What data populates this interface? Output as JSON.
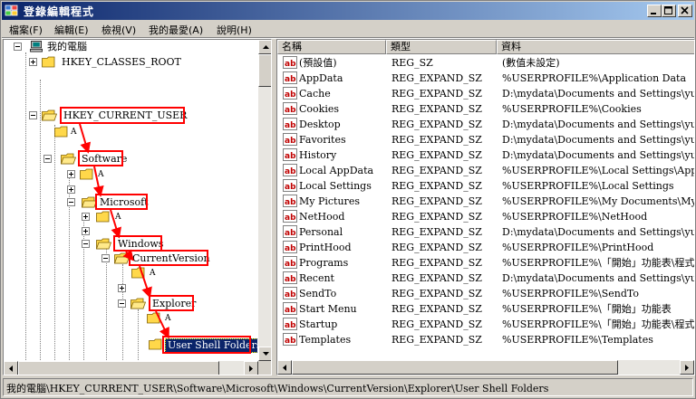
{
  "window": {
    "title": "登錄編輯程式"
  },
  "menu": [
    {
      "label": "檔案(F)"
    },
    {
      "label": "編輯(E)"
    },
    {
      "label": "檢視(V)"
    },
    {
      "label": "我的最愛(A)"
    },
    {
      "label": "說明(H)"
    }
  ],
  "tree": {
    "root": "我的電腦",
    "nodes": [
      {
        "label": "HKEY_CLASSES_ROOT"
      },
      {
        "label": "HKEY_CURRENT_USER"
      },
      {
        "label": "A"
      },
      {
        "label": "Software"
      },
      {
        "label": "A"
      },
      {
        "label": "Microsoft"
      },
      {
        "label": "A"
      },
      {
        "label": "Windows"
      },
      {
        "label": "CurrentVersion"
      },
      {
        "label": "A"
      },
      {
        "label": "Explorer"
      },
      {
        "label": "A"
      },
      {
        "label": "User Shell Folders"
      }
    ]
  },
  "list": {
    "columns": [
      "名稱",
      "類型",
      "資料"
    ],
    "rows": [
      {
        "name": "(預設值)",
        "type": "REG_SZ",
        "data": "(數值未設定)"
      },
      {
        "name": "AppData",
        "type": "REG_EXPAND_SZ",
        "data": "%USERPROFILE%\\Application Data"
      },
      {
        "name": "Cache",
        "type": "REG_EXPAND_SZ",
        "data": "D:\\mydata\\Documents and Settings\\yuanhung"
      },
      {
        "name": "Cookies",
        "type": "REG_EXPAND_SZ",
        "data": "%USERPROFILE%\\Cookies"
      },
      {
        "name": "Desktop",
        "type": "REG_EXPAND_SZ",
        "data": "D:\\mydata\\Documents and Settings\\yuanhung"
      },
      {
        "name": "Favorites",
        "type": "REG_EXPAND_SZ",
        "data": "D:\\mydata\\Documents and Settings\\yuanhung"
      },
      {
        "name": "History",
        "type": "REG_EXPAND_SZ",
        "data": "D:\\mydata\\Documents and Settings\\yuanhung"
      },
      {
        "name": "Local AppData",
        "type": "REG_EXPAND_SZ",
        "data": "%USERPROFILE%\\Local Settings\\Applicati"
      },
      {
        "name": "Local Settings",
        "type": "REG_EXPAND_SZ",
        "data": "%USERPROFILE%\\Local Settings"
      },
      {
        "name": "My Pictures",
        "type": "REG_EXPAND_SZ",
        "data": "%USERPROFILE%\\My Documents\\My Pictu"
      },
      {
        "name": "NetHood",
        "type": "REG_EXPAND_SZ",
        "data": "%USERPROFILE%\\NetHood"
      },
      {
        "name": "Personal",
        "type": "REG_EXPAND_SZ",
        "data": "D:\\mydata\\Documents and Settings\\yuanhung"
      },
      {
        "name": "PrintHood",
        "type": "REG_EXPAND_SZ",
        "data": "%USERPROFILE%\\PrintHood"
      },
      {
        "name": "Programs",
        "type": "REG_EXPAND_SZ",
        "data": "%USERPROFILE%\\「開始」功能表\\程式集"
      },
      {
        "name": "Recent",
        "type": "REG_EXPAND_SZ",
        "data": "D:\\mydata\\Documents and Settings\\yuanhung"
      },
      {
        "name": "SendTo",
        "type": "REG_EXPAND_SZ",
        "data": "%USERPROFILE%\\SendTo"
      },
      {
        "name": "Start Menu",
        "type": "REG_EXPAND_SZ",
        "data": "%USERPROFILE%\\「開始」功能表"
      },
      {
        "name": "Startup",
        "type": "REG_EXPAND_SZ",
        "data": "%USERPROFILE%\\「開始」功能表\\程式集"
      },
      {
        "name": "Templates",
        "type": "REG_EXPAND_SZ",
        "data": "%USERPROFILE%\\Templates"
      }
    ]
  },
  "status": {
    "path": "我的電腦\\HKEY_CURRENT_USER\\Software\\Microsoft\\Windows\\CurrentVersion\\Explorer\\User Shell Folders"
  },
  "colors": {
    "highlight": "#ff0000",
    "selection": "#0a246a",
    "title_start": "#0a246a",
    "title_end": "#a6caf0",
    "folder": "#ffd84a"
  },
  "icons": [
    "regedit-app-icon",
    "minimize-icon",
    "maximize-icon",
    "close-icon",
    "computer-icon",
    "folder-icon",
    "folder-open-icon",
    "string-value-icon",
    "arrow-up-icon",
    "arrow-down-icon",
    "arrow-left-icon",
    "arrow-right-icon"
  ]
}
